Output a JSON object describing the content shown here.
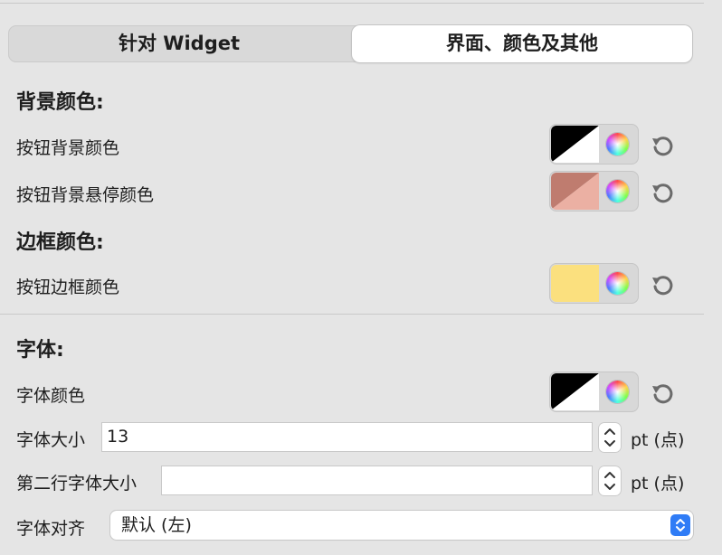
{
  "tabs": [
    {
      "label": "针对 Widget",
      "selected": false
    },
    {
      "label": "界面、颜色及其他",
      "selected": true
    }
  ],
  "sections": {
    "background": {
      "title": "背景颜色:",
      "rows": [
        {
          "label": "按钮背景颜色",
          "swatch": [
            "#000000",
            "#ffffff"
          ]
        },
        {
          "label": "按钮背景悬停颜色",
          "swatch": [
            "#bf7c6f",
            "#ebb0a3"
          ]
        }
      ]
    },
    "border": {
      "title": "边框颜色:",
      "rows": [
        {
          "label": "按钮边框颜色",
          "swatch": [
            "#fbe07e",
            "#fbe07e"
          ]
        }
      ]
    },
    "font": {
      "title": "字体:",
      "color_label": "字体颜色",
      "color_swatch": [
        "#000000",
        "#ffffff"
      ],
      "size_label": "字体大小",
      "size_value": "13",
      "size_unit": "pt (点)",
      "second_size_label": "第二行字体大小",
      "second_size_value": "",
      "second_size_unit": "pt (点)",
      "align_label": "字体对齐",
      "align_value": "默认 (左)"
    }
  },
  "icons": {
    "reset": "reset-arrow-icon",
    "color_wheel": "color-wheel-icon",
    "stepper": "stepper-chevrons-icon",
    "popup": "popup-chevrons-icon"
  },
  "colors": {
    "accent": "#2f7cf6",
    "background": "#e5e5e5"
  }
}
